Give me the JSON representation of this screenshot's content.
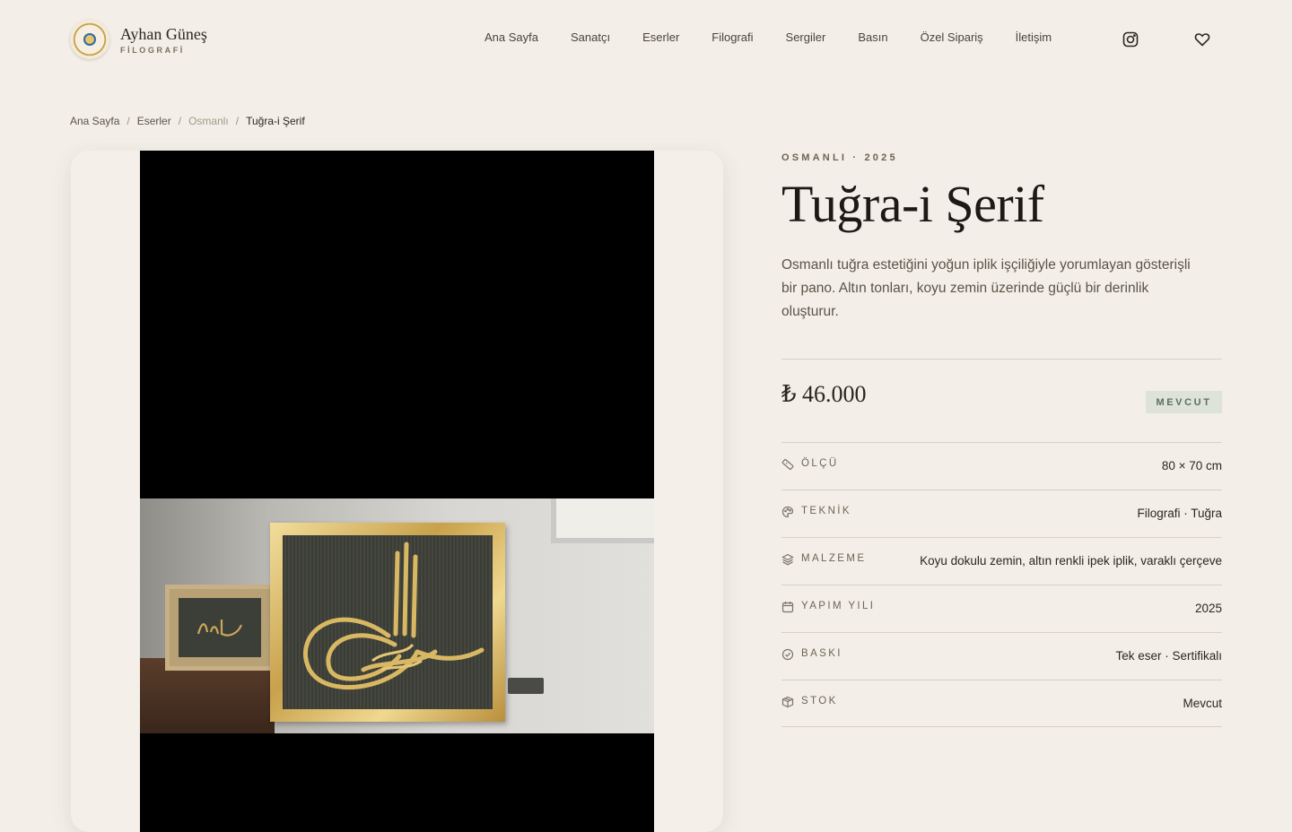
{
  "brand": {
    "name": "Ayhan Güneş",
    "subtitle": "FİLOGRAFİ"
  },
  "nav": {
    "items": [
      {
        "label": "Ana Sayfa"
      },
      {
        "label": "Sanatçı"
      },
      {
        "label": "Eserler"
      },
      {
        "label": "Filografi"
      },
      {
        "label": "Sergiler"
      },
      {
        "label": "Basın"
      },
      {
        "label": "Özel Sipariş"
      },
      {
        "label": "İletişim"
      }
    ],
    "icons": [
      "instagram-icon",
      "heart-icon"
    ]
  },
  "breadcrumb": {
    "items": [
      "Ana Sayfa",
      "Eserler",
      "Osmanlı",
      "Tuğra-i Şerif"
    ],
    "separator": "/"
  },
  "product": {
    "meta": "OSMANLI · 2025",
    "title": "Tuğra-i Şerif",
    "description": "Osmanlı tuğra estetiğini yoğun iplik işçiliğiyle yorumlayan gösterişli bir pano. Altın tonları, koyu zemin üzerinde güçlü bir derinlik oluşturur.",
    "price": "₺ 46.000",
    "availability_badge": "MEVCUT",
    "specs": [
      {
        "icon": "ruler-icon",
        "label": "ÖLÇÜ",
        "value": "80 × 70 cm"
      },
      {
        "icon": "palette-icon",
        "label": "TEKNİK",
        "value": "Filografi · Tuğra"
      },
      {
        "icon": "layers-icon",
        "label": "MALZEME",
        "value": "Koyu dokulu zemin, altın renkli ipek iplik, varaklı çerçeve"
      },
      {
        "icon": "calendar-icon",
        "label": "YAPIM YILI",
        "value": "2025"
      },
      {
        "icon": "check-circle-icon",
        "label": "BASKI",
        "value": "Tek eser · Sertifikalı"
      },
      {
        "icon": "box-icon",
        "label": "STOK",
        "value": "Mevcut"
      }
    ]
  },
  "colors": {
    "background": "#f3efe8",
    "badge_bg": "#dde3d9",
    "badge_text": "#5d7060",
    "text_primary": "#1d1a16",
    "text_muted": "#5a5347"
  }
}
